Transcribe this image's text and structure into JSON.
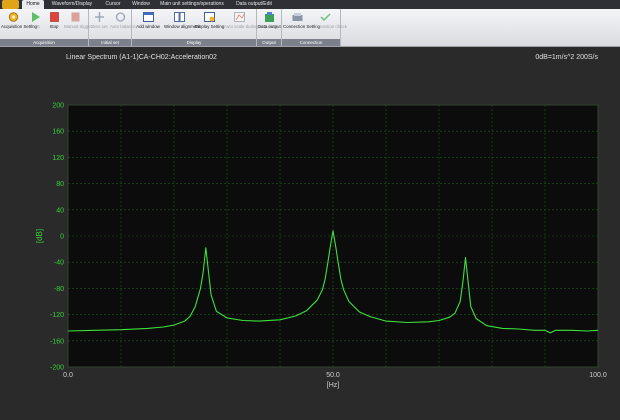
{
  "tabs": [
    "Home",
    "Waveform/Display",
    "Cursor",
    "Window",
    "Main unit settings/operations",
    "Data output/Edit"
  ],
  "ribbon": {
    "groups": [
      {
        "label": "Acquisition",
        "buttons": [
          {
            "label": "Acquisition Setting",
            "icon": "gear-icon",
            "enabled": true
          },
          {
            "label": "Start",
            "icon": "play-icon",
            "enabled": false
          },
          {
            "label": "Stop",
            "icon": "stop-icon",
            "enabled": true
          },
          {
            "label": "Manual trigger",
            "icon": "trigger-icon",
            "enabled": false
          }
        ]
      },
      {
        "label": "Initial set",
        "buttons": [
          {
            "label": "Zero set",
            "icon": "zero-set-icon",
            "enabled": false
          },
          {
            "label": "Auto balance",
            "icon": "balance-icon",
            "enabled": false
          }
        ]
      },
      {
        "label": "Display",
        "buttons": [
          {
            "label": "Add window",
            "icon": "add-window-icon",
            "enabled": true
          },
          {
            "label": "Window alignment",
            "icon": "window-align-icon",
            "enabled": true
          },
          {
            "label": "Display Setting",
            "icon": "display-setting-icon",
            "enabled": true
          },
          {
            "label": "Auto scale during acquiring",
            "icon": "autoscale-icon",
            "enabled": false
          }
        ]
      },
      {
        "label": "Output",
        "buttons": [
          {
            "label": "Data output",
            "icon": "data-output-icon",
            "enabled": true
          }
        ]
      },
      {
        "label": "Connection",
        "buttons": [
          {
            "label": "Connection Setting",
            "icon": "connection-icon",
            "enabled": true
          },
          {
            "label": "Connection check",
            "icon": "check-icon",
            "enabled": false
          }
        ]
      }
    ]
  },
  "panel": {
    "title": "Linear Spectrum  (A1-1)CA-CH02:Acceleration02",
    "rate": "0dB=1m/s^2   200S/s"
  },
  "colors": {
    "trace": "#3ee03e",
    "axis_text": "#39d139",
    "grid": "#1c5c1c",
    "plot_bg": "#0c0c0c"
  },
  "chart_data": {
    "type": "line",
    "xlabel": "[Hz]",
    "ylabel": "[dB]",
    "xlim": [
      0,
      100
    ],
    "ylim": [
      -200,
      200
    ],
    "xticks": [
      0,
      50,
      100
    ],
    "xtick_labels": [
      "0.0",
      "50.0",
      "100.0"
    ],
    "yticks": [
      200,
      160,
      120,
      80,
      40,
      0,
      -40,
      -80,
      -120,
      -160,
      -200
    ],
    "grid": true,
    "series": [
      {
        "x": [
          0,
          5,
          10,
          15,
          18,
          20,
          22,
          23,
          24,
          25,
          25.5,
          26,
          26.5,
          27,
          28,
          30,
          33,
          36,
          40,
          43,
          45,
          47,
          48,
          48.5,
          49,
          49.5,
          50,
          50.5,
          51,
          51.5,
          52,
          53,
          55,
          57,
          60,
          64,
          68,
          70,
          72,
          73,
          74,
          74.5,
          75,
          75.5,
          76,
          77,
          79,
          82,
          85,
          88,
          90,
          91,
          92,
          95,
          98,
          100
        ],
        "y": [
          -145,
          -144,
          -143,
          -141,
          -139,
          -136,
          -130,
          -123,
          -108,
          -80,
          -55,
          -18,
          -55,
          -90,
          -115,
          -125,
          -129,
          -130,
          -128,
          -122,
          -114,
          -98,
          -82,
          -66,
          -42,
          -15,
          8,
          -15,
          -42,
          -66,
          -82,
          -100,
          -116,
          -123,
          -130,
          -132,
          -131,
          -129,
          -124,
          -118,
          -100,
          -70,
          -33,
          -70,
          -108,
          -126,
          -137,
          -141,
          -142,
          -144,
          -144,
          -148,
          -144,
          -144,
          -145,
          -144
        ]
      }
    ]
  }
}
